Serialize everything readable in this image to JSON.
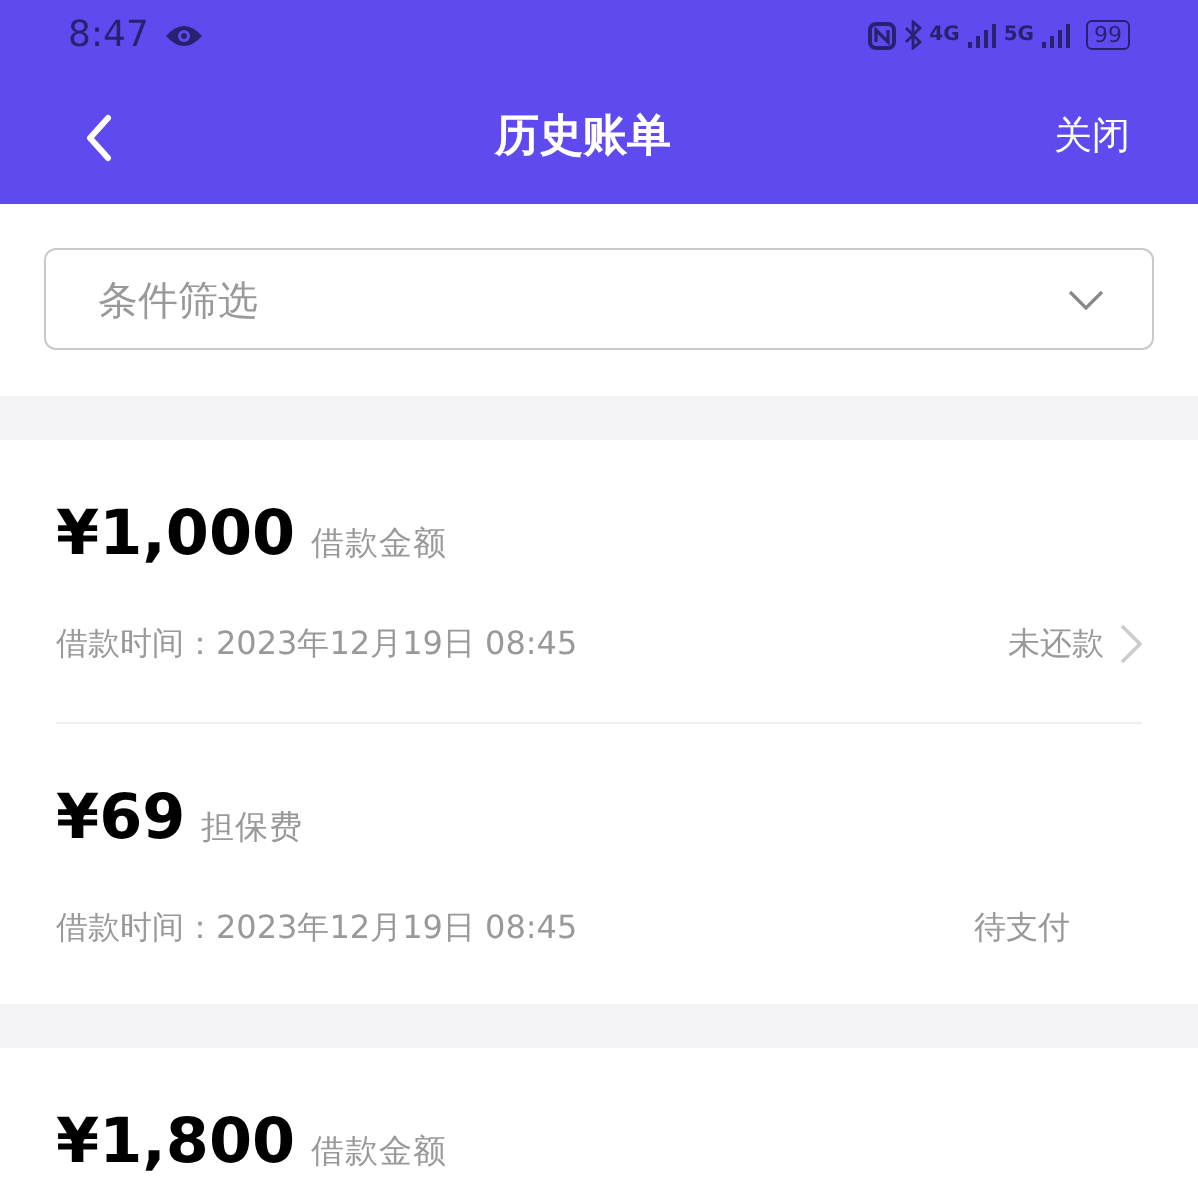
{
  "status_bar": {
    "time": "8:47",
    "network_1": "4G",
    "network_2": "5G",
    "battery": "99"
  },
  "header": {
    "title": "历史账单",
    "close": "关闭"
  },
  "filter": {
    "placeholder": "条件筛选"
  },
  "groups": [
    {
      "items": [
        {
          "amount": "¥1,000",
          "label": "借款金额",
          "time_label": "借款时间：",
          "time": "2023年12月19日 08:45",
          "status": "未还款",
          "has_arrow": true
        },
        {
          "amount": "¥69",
          "label": "担保费",
          "time_label": "借款时间：",
          "time": "2023年12月19日 08:45",
          "status": "待支付",
          "has_arrow": false
        }
      ]
    },
    {
      "items": [
        {
          "amount": "¥1,800",
          "label": "借款金额"
        }
      ]
    }
  ]
}
